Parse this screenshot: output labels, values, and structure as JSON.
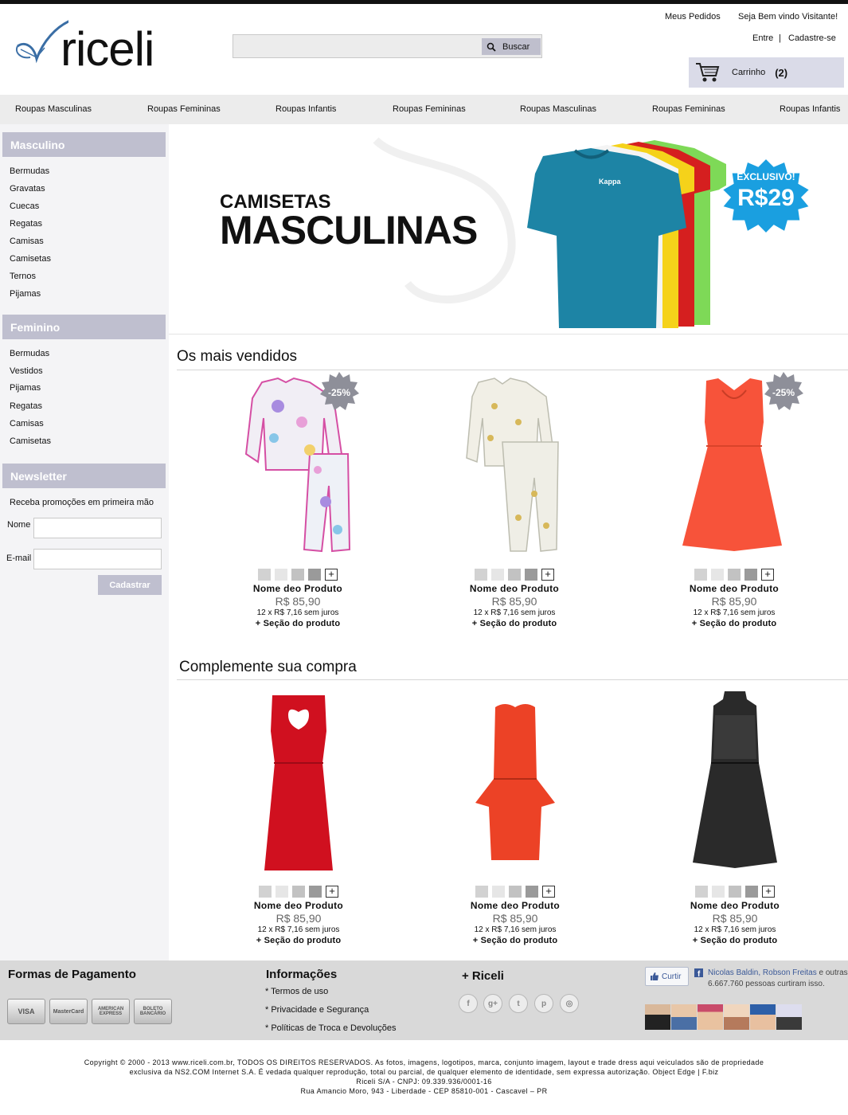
{
  "header": {
    "logo_text": "riceli",
    "search_placeholder": "",
    "search_button": "Buscar",
    "my_orders": "Meus Pedidos",
    "welcome": "Seja Bem vindo Visitante!",
    "login": "Entre",
    "separator": "|",
    "register": "Cadastre-se",
    "cart_label": "Carrinho",
    "cart_count": "(2)"
  },
  "nav": {
    "items": [
      "Roupas Masculinas",
      "Roupas Femininas",
      "Roupas Infantis",
      "Roupas Femininas",
      "Roupas Masculinas",
      "Roupas Femininas",
      "Roupas Infantis"
    ]
  },
  "sidebar": {
    "masculino": {
      "title": "Masculino",
      "items": [
        "Bermudas",
        "Gravatas",
        "Cuecas",
        "Regatas",
        "Camisas",
        "Camisetas",
        "Ternos",
        "Pijamas"
      ]
    },
    "feminino": {
      "title": "Feminino",
      "items": [
        "Bermudas",
        "Vestidos",
        "Pijamas",
        "Regatas",
        "Camisas",
        "Camisetas"
      ]
    },
    "newsletter": {
      "title": "Newsletter",
      "text": "Receba promoções em primeira mão",
      "name_label": "Nome",
      "email_label": "E-mail",
      "button": "Cadastrar"
    }
  },
  "banner": {
    "subtitle": "CAMISETAS",
    "title": "MASCULINAS",
    "badge_top": "EXCLUSIVO!",
    "badge_price": "R$29",
    "shirt_brand": "Kappa"
  },
  "bestsellers": {
    "title": "Os mais vendidos",
    "products": [
      {
        "name": "Nome deo Produto",
        "price": "R$ 85,90",
        "installments": "12 x R$ 7,16 sem juros",
        "link": "+ Seção do produto",
        "discount": "-25%"
      },
      {
        "name": "Nome deo Produto",
        "price": "R$ 85,90",
        "installments": "12 x R$ 7,16 sem juros",
        "link": "+ Seção do produto",
        "discount": ""
      },
      {
        "name": "Nome deo Produto",
        "price": "R$ 85,90",
        "installments": "12 x R$ 7,16 sem juros",
        "link": "+ Seção do produto",
        "discount": "-25%"
      }
    ]
  },
  "complement": {
    "title": "Complemente sua compra",
    "products": [
      {
        "name": "Nome deo Produto",
        "price": "R$ 85,90",
        "installments": "12 x R$ 7,16 sem juros",
        "link": "+ Seção do produto"
      },
      {
        "name": "Nome deo Produto",
        "price": "R$ 85,90",
        "installments": "12 x R$ 7,16 sem juros",
        "link": "+ Seção do produto"
      },
      {
        "name": "Nome deo Produto",
        "price": "R$ 85,90",
        "installments": "12 x R$ 7,16 sem juros",
        "link": "+ Seção do produto"
      }
    ]
  },
  "swatch_plus": "+",
  "footer": {
    "payment_title": "Formas de Pagamento",
    "payment_methods": [
      "VISA",
      "MasterCard",
      "AMERICAN EXPRESS",
      "BOLETO BANCÁRIO"
    ],
    "info_title": "Informações",
    "info_links": [
      "* Termos de uso",
      "* Privacidade e Segurança",
      "* Políticas de Troca e Devoluções"
    ],
    "riceli_title": "+ Riceli",
    "social_icons": [
      "facebook-icon",
      "google-plus-icon",
      "twitter-icon",
      "pinterest-icon",
      "instagram-icon"
    ],
    "social_glyphs": [
      "f",
      "g+",
      "t",
      "p",
      "◎"
    ],
    "fb_like": "Curtir",
    "fb_names": "Nicolas Baldin, Robson Freitas",
    "fb_rest": "e outras 6.667.760 pessoas curtiram isso."
  },
  "copyright": {
    "line1": "Copyright © 2000 - 2013 www.riceli.com.br, TODOS OS DIREITOS RESERVADOS. As fotos, imagens, logotipos, marca, conjunto imagem, layout e trade dress aqui veiculados são de propriedade",
    "line2": "exclusiva da NS2.COM Internet S.A. É vedada qualquer reprodução, total ou parcial, de qualquer elemento de identidade, sem expressa autorização. Object Edge | F.biz",
    "line3": "Riceli S/A - CNPJ: 09.339.936/0001-16",
    "line4": "Rua Amancio Moro, 943 - Liberdade - CEP 85810-001 - Cascavel – PR"
  },
  "colors": {
    "accent": "#bfbfcf",
    "cart_bg": "#dadbe8",
    "badge_blue": "#1a9fe0",
    "logo_blue": "#3a6ea5"
  }
}
